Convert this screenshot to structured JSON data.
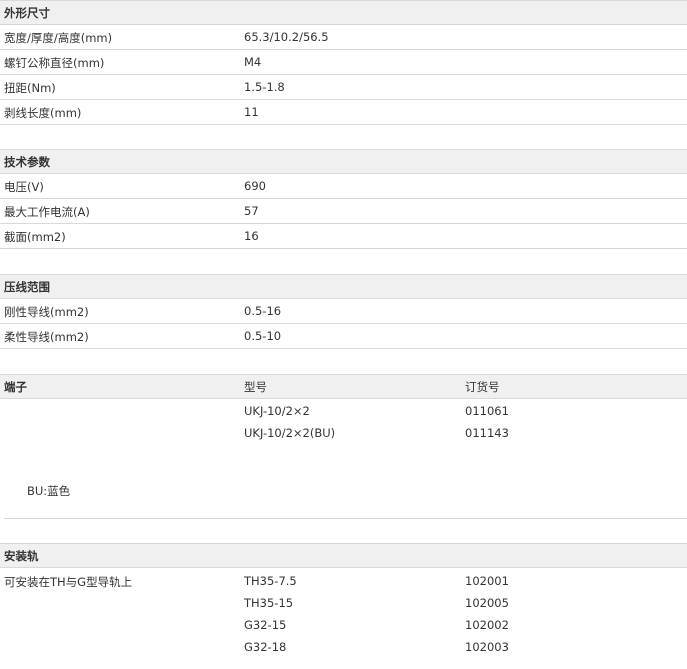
{
  "dimensions": {
    "title": "外形尺寸",
    "rows": [
      {
        "label": "宽度/厚度/高度(mm)",
        "value": "65.3/10.2/56.5"
      },
      {
        "label": "螺钉公称直径(mm)",
        "value": "M4"
      },
      {
        "label": "扭距(Nm)",
        "value": "1.5-1.8"
      },
      {
        "label": "剥线长度(mm)",
        "value": "11"
      }
    ]
  },
  "technical": {
    "title": "技术参数",
    "rows": [
      {
        "label": "电压(V)",
        "value": "690"
      },
      {
        "label": "最大工作电流(A)",
        "value": "57"
      },
      {
        "label": "截面(mm2)",
        "value": "16"
      }
    ]
  },
  "crimp": {
    "title": "压线范围",
    "rows": [
      {
        "label": "刚性导线(mm2)",
        "value": "0.5-16"
      },
      {
        "label": "柔性导线(mm2)",
        "value": "0.5-10"
      }
    ]
  },
  "terminal": {
    "title": "端子",
    "col_model": "型号",
    "col_order": "订货号",
    "rows": [
      {
        "model": "UKJ-10/2×2",
        "order": "011061"
      },
      {
        "model": "UKJ-10/2×2(BU)",
        "order": "011143"
      }
    ],
    "note": "BU:蓝色"
  },
  "rail": {
    "title": "安装轨",
    "description": "可安装在TH与G型导轨上",
    "rows": [
      {
        "model": "TH35-7.5",
        "order": "102001"
      },
      {
        "model": "TH35-15",
        "order": "102005"
      },
      {
        "model": "G32-15",
        "order": "102002"
      },
      {
        "model": "G32-18",
        "order": "102003"
      }
    ]
  }
}
